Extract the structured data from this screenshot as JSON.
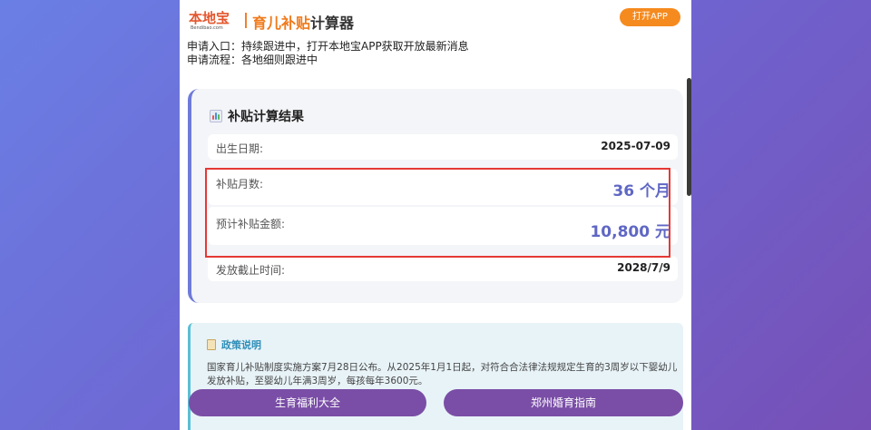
{
  "header": {
    "logo_text": "本地宝",
    "logo_sub": "Bendibao.com",
    "title_accent": "育儿补贴",
    "title_rest": "计算器",
    "open_app_label": "打开APP"
  },
  "info": {
    "apply_entry": "申请入口：持续跟进中，打开本地宝APP获取开放最新消息",
    "apply_process": "申请流程：各地细则跟进中"
  },
  "result": {
    "title": "补贴计算结果",
    "rows": [
      {
        "label": "出生日期:",
        "value": "2025-07-09"
      },
      {
        "label": "补贴月数:",
        "value": "36 个月"
      },
      {
        "label": "预计补贴金额:",
        "value": "10,800 元"
      },
      {
        "label": "发放截止时间:",
        "value": "2028/7/9"
      }
    ]
  },
  "policy": {
    "title": "政策说明",
    "text": "国家育儿补贴制度实施方案7月28日公布。从2025年1月1日起，对符合合法律法规规定生育的3周岁以下婴幼儿发放补贴，至婴幼儿年满3周岁，每孩每年3600元。"
  },
  "bottom": {
    "left_button": "生育福利大全",
    "right_button": "郑州婚育指南"
  },
  "colors": {
    "accent_orange": "#f58a1f",
    "result_value": "#5f67c4",
    "highlight_border": "#e53935",
    "button_purple": "#7a4ea6"
  }
}
